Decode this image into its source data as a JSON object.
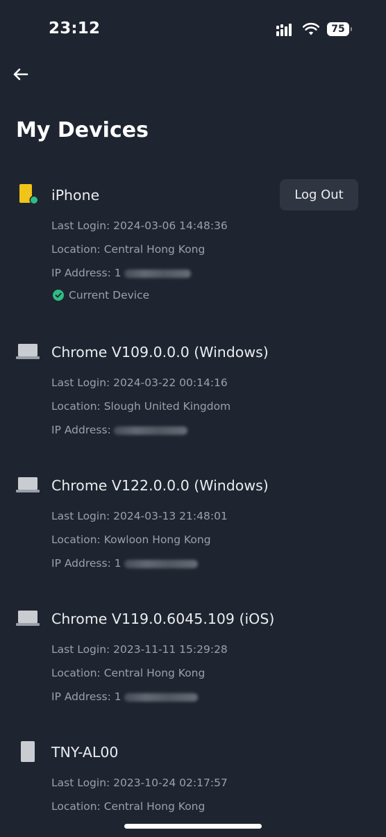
{
  "status_bar": {
    "time": "23:12",
    "battery_level": "75",
    "icons": [
      "signal-icon",
      "wifi-icon",
      "battery-icon"
    ]
  },
  "header": {
    "back_icon": "arrow-left-icon",
    "title": "My Devices"
  },
  "devices": [
    {
      "name": "iPhone",
      "icon": "phone-icon",
      "icon_color": "#f0c419",
      "online_dot_color": "#2ebd85",
      "last_login": "Last Login: 2024-03-06 14:48:36",
      "location": "Location: Central Hong Kong",
      "ip_label": "IP Address: 1",
      "logout_label": "Log Out",
      "current_label": "Current Device"
    },
    {
      "name": "Chrome V109.0.0.0 (Windows)",
      "icon": "laptop-icon",
      "last_login": "Last Login: 2024-03-22 00:14:16",
      "location": "Location: Slough United Kingdom",
      "ip_label": "IP Address:"
    },
    {
      "name": "Chrome V122.0.0.0 (Windows)",
      "icon": "laptop-icon",
      "last_login": "Last Login: 2024-03-13 21:48:01",
      "location": "Location: Kowloon Hong Kong",
      "ip_label": "IP Address: 1"
    },
    {
      "name": "Chrome V119.0.6045.109 (iOS)",
      "icon": "laptop-icon",
      "last_login": "Last Login: 2023-11-11 15:29:28",
      "location": "Location: Central Hong Kong",
      "ip_label": "IP Address: 1"
    },
    {
      "name": "TNY-AL00",
      "icon": "phone-icon",
      "last_login": "Last Login: 2023-10-24 02:17:57",
      "location": "Location: Central Hong Kong"
    }
  ],
  "colors": {
    "background": "#1f2530",
    "button_background": "#2f3541",
    "secondary_text": "#9aa1ab",
    "success": "#2ebd85",
    "icon_gray": "#c9ccd1"
  }
}
